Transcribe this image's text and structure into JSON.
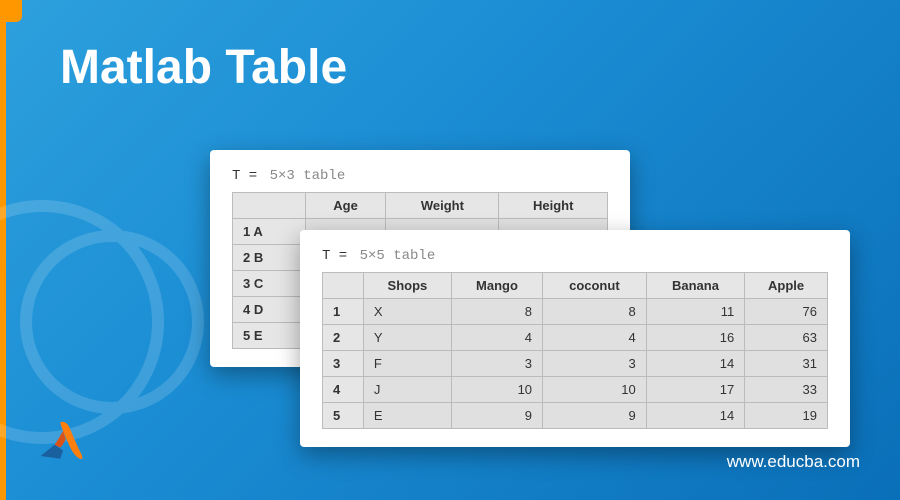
{
  "title": "Matlab Table",
  "back_card": {
    "caption_var": "T =",
    "caption_dim": "5×3 table",
    "headers": [
      "",
      "Age",
      "Weight",
      "Height"
    ],
    "rows": [
      {
        "label": "1 A"
      },
      {
        "label": "2 B"
      },
      {
        "label": "3 C"
      },
      {
        "label": "4 D"
      },
      {
        "label": "5 E"
      }
    ]
  },
  "front_card": {
    "caption_var": "T =",
    "caption_dim": "5×5 table",
    "headers": [
      "",
      "Shops",
      "Mango",
      "coconut",
      "Banana",
      "Apple"
    ],
    "rows": [
      {
        "label": "1",
        "shop": "X",
        "mango": 8,
        "coconut": 8,
        "banana": 11,
        "apple": 76
      },
      {
        "label": "2",
        "shop": "Y",
        "mango": 4,
        "coconut": 4,
        "banana": 16,
        "apple": 63
      },
      {
        "label": "3",
        "shop": "F",
        "mango": 3,
        "coconut": 3,
        "banana": 14,
        "apple": 31
      },
      {
        "label": "4",
        "shop": "J",
        "mango": 10,
        "coconut": 10,
        "banana": 17,
        "apple": 33
      },
      {
        "label": "5",
        "shop": "E",
        "mango": 9,
        "coconut": 9,
        "banana": 14,
        "apple": 19
      }
    ]
  },
  "footer": {
    "url": "www.educba.com",
    "logo_alt": "matlab-logo"
  }
}
